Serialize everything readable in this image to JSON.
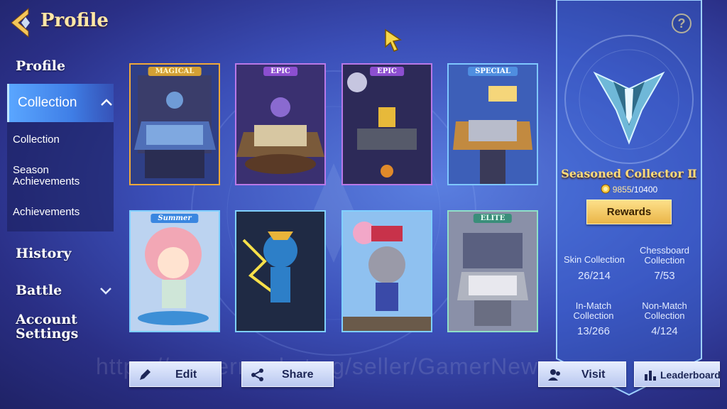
{
  "header": {
    "title": "Profile",
    "help_label": "?"
  },
  "sidebar": {
    "profile": "Profile",
    "collection": "Collection",
    "sub_items": [
      "Collection",
      "Season Achievements",
      "Achievements"
    ],
    "history": "History",
    "battle": "Battle",
    "account_line1": "Account",
    "account_line2": "Settings"
  },
  "cards": [
    {
      "tag": "MAGICAL",
      "kind": "chessboard"
    },
    {
      "tag": "EPIC",
      "kind": "chessboard"
    },
    {
      "tag": "EPIC",
      "kind": "chessboard"
    },
    {
      "tag": "SPECIAL",
      "kind": "chessboard"
    },
    {
      "tag": "Summer",
      "kind": "character"
    },
    {
      "tag": "",
      "kind": "character"
    },
    {
      "tag": "",
      "kind": "character"
    },
    {
      "tag": "ELITE",
      "kind": "chessboard"
    }
  ],
  "rank": {
    "title": "Seasoned Collector Ⅱ",
    "progress_current": "9855",
    "progress_total": "/10400",
    "rewards_label": "Rewards"
  },
  "stats": {
    "skin": {
      "line1": "Skin Collection",
      "line2": "",
      "value": "26/214"
    },
    "chessboard": {
      "line1": "Chessboard",
      "line2": "Collection",
      "value": "7/53"
    },
    "inmatch": {
      "line1": "In-Match",
      "line2": "Collection",
      "value": "13/266"
    },
    "nonmatch": {
      "line1": "Non-Match",
      "line2": "Collection",
      "value": "4/124"
    }
  },
  "buttons": {
    "edit": "Edit",
    "share": "Share",
    "visit": "Visit",
    "leaderboard": "Leaderboard"
  },
  "watermark": "https://gamermarket.gg/seller/GamerNews",
  "colors": {
    "accent_gold": "#ffdc7a",
    "panel_blue": "#3f7ee6"
  }
}
